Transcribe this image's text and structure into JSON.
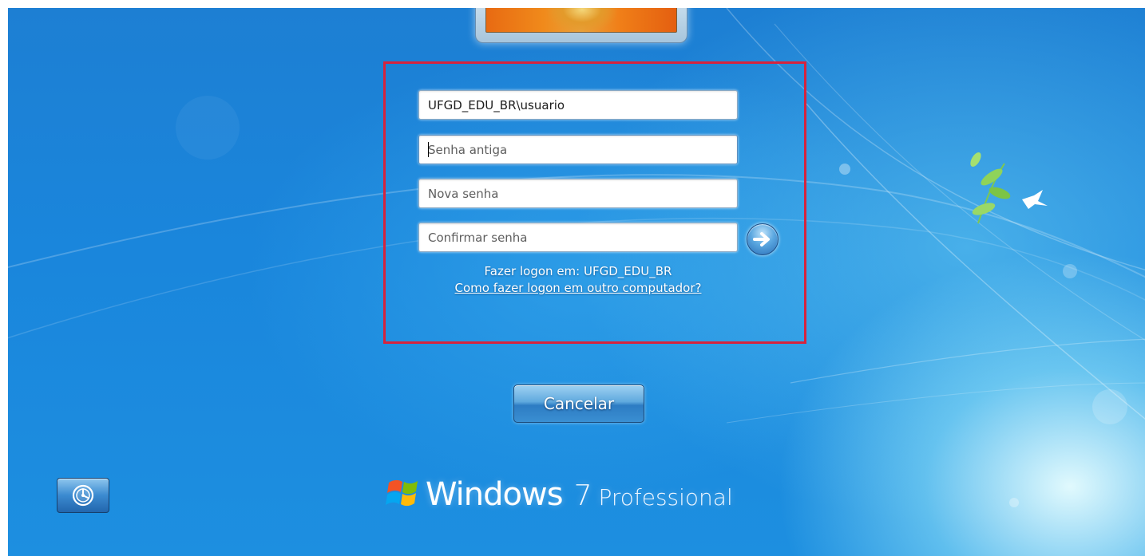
{
  "logon": {
    "username_value": "UFGD_EDU_BR\\usuario",
    "old_password_placeholder": "Senha antiga",
    "new_password_placeholder": "Nova senha",
    "confirm_password_placeholder": "Confirmar senha",
    "logon_to": "Fazer logon em: UFGD_EDU_BR",
    "other_computer_link": "Como fazer logon em outro computador?",
    "submit_icon": "arrow-right-icon"
  },
  "buttons": {
    "cancel_label": "Cancelar",
    "ease_of_access_icon": "ease-of-access-icon"
  },
  "brand": {
    "word": "Windows",
    "version": "7",
    "edition": "Professional"
  },
  "colors": {
    "highlight_border": "#d6233d",
    "background": "#1a86dc"
  }
}
